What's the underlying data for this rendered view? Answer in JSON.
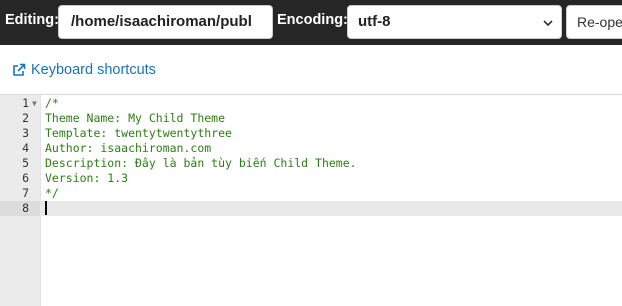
{
  "toolbar": {
    "editing_label": "Editing:",
    "path_value": "/home/isaachiroman/publ",
    "encoding_label": "Encoding:",
    "encoding_selected": "utf-8",
    "reopen_label": "Re-ope"
  },
  "shortcuts": {
    "label": "Keyboard shortcuts",
    "icon": "external-link-icon"
  },
  "editor": {
    "lines": [
      {
        "number": "1",
        "text": "/*"
      },
      {
        "number": "2",
        "text": "Theme Name: My Child Theme"
      },
      {
        "number": "3",
        "text": "Template: twentytwentythree"
      },
      {
        "number": "4",
        "text": "Author: isaachiroman.com"
      },
      {
        "number": "5",
        "text": "Description: Đây là bản tùy biến Child Theme."
      },
      {
        "number": "6",
        "text": "Version: 1.3"
      },
      {
        "number": "7",
        "text": "*/"
      },
      {
        "number": "8",
        "text": ""
      }
    ],
    "active_line": 8,
    "comment_color": "#2e7d16"
  },
  "colors": {
    "toolbar_bg": "#262626",
    "link": "#1a73b8",
    "gutter_bg": "#ebebeb"
  }
}
